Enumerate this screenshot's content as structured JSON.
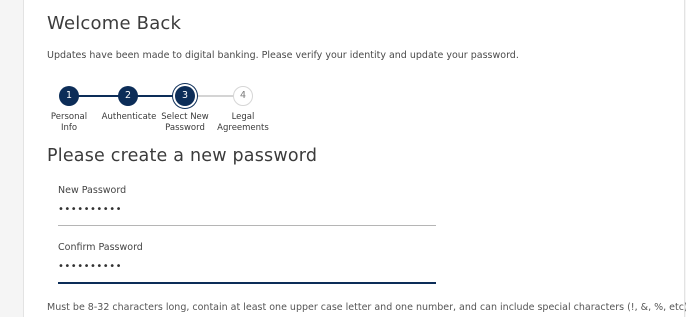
{
  "header": {
    "title": "Welcome Back",
    "subtitle": "Updates have been made to digital banking. Please verify your identity and update your password."
  },
  "stepper": {
    "steps": [
      {
        "number": "1",
        "label_line1": "Personal",
        "label_line2": "Info",
        "status": "done"
      },
      {
        "number": "2",
        "label_line1": "Authenticate",
        "label_line2": "",
        "status": "done"
      },
      {
        "number": "3",
        "label_line1": "Select New",
        "label_line2": "Password",
        "status": "current"
      },
      {
        "number": "4",
        "label_line1": "Legal",
        "label_line2": "Agreements",
        "status": "pending"
      }
    ],
    "active_color": "#0c2d58",
    "inactive_color": "#d4d4d4"
  },
  "form": {
    "heading": "Please create a new password",
    "new_password": {
      "label": "New Password",
      "value": "••••••••••"
    },
    "confirm_password": {
      "label": "Confirm Password",
      "value": "••••••••••"
    },
    "hint": "Must be 8-32 characters long, contain at least one upper case letter and one number, and can include special characters (!, &, %, etc)"
  }
}
